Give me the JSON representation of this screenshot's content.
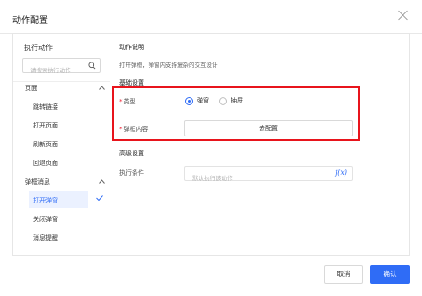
{
  "dialog": {
    "title": "动作配置"
  },
  "left": {
    "title": "执行动作",
    "search_placeholder": "请搜索执行动作",
    "groups": [
      {
        "label": "页面",
        "children": [
          "跳转链接",
          "打开页面",
          "刷新页面",
          "回退页面"
        ]
      },
      {
        "label": "弹框消息",
        "children": [
          "打开弹窗",
          "关闭弹窗",
          "消息提醒"
        ]
      }
    ],
    "selected": "打开弹窗"
  },
  "right": {
    "desc_title": "动作说明",
    "desc_text": "打开弹框，弹窗内支持复杂的交互设计",
    "basic_title": "基础设置",
    "type_label": "类型",
    "type_options": [
      "弹窗",
      "抽屉"
    ],
    "type_selected": "弹窗",
    "content_label": "弹框内容",
    "config_button": "去配置",
    "advanced_title": "高级设置",
    "condition_label": "执行条件",
    "condition_placeholder": "默认执行该动作",
    "fx_label": "f(x)"
  },
  "footer": {
    "cancel": "取消",
    "ok": "确认"
  },
  "colors": {
    "primary": "#2f6cf6",
    "highlight_box": "#e8141c",
    "selected_bg": "#ebf1ff"
  }
}
